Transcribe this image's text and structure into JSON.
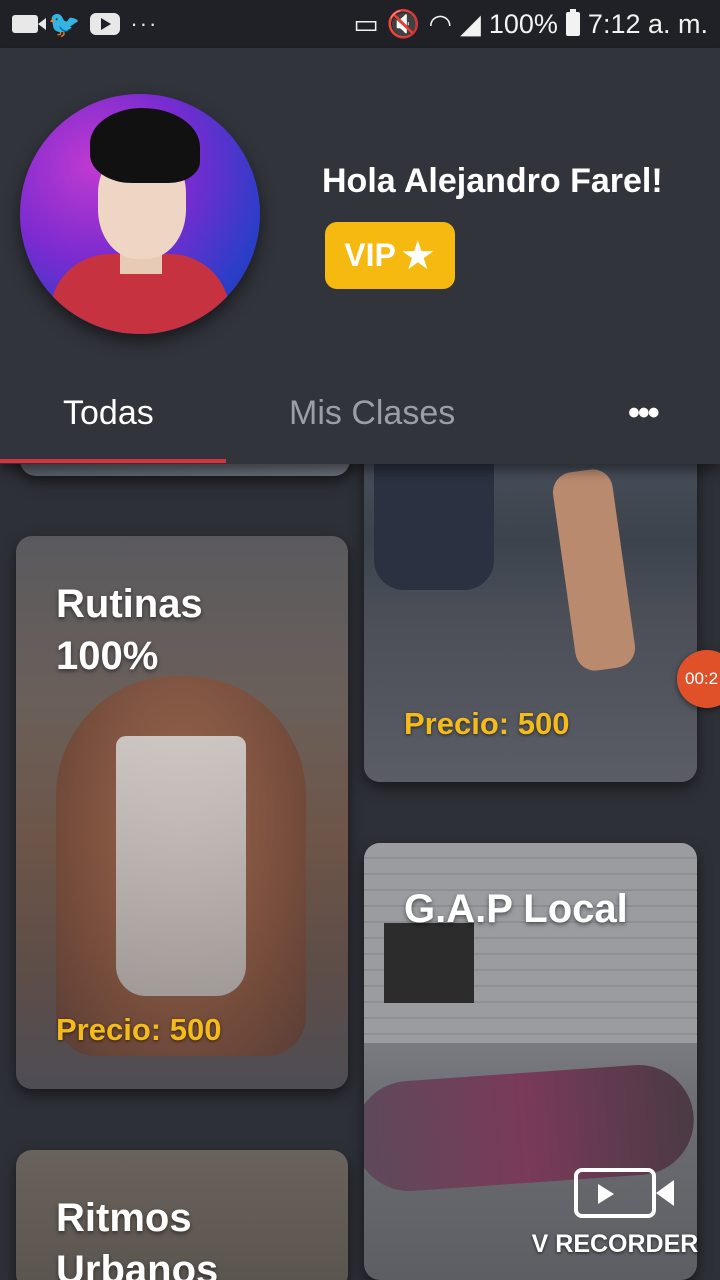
{
  "status_bar": {
    "battery": "100%",
    "time": "7:12 a. m.",
    "left_icons": [
      "video-camera-icon",
      "twitter-icon",
      "youtube-icon",
      "more-notifications-icon"
    ],
    "right_icons": [
      "cast-icon",
      "mute-icon",
      "wifi-icon",
      "signal-icon",
      "battery-icon"
    ]
  },
  "profile": {
    "greeting": "Hola Alejandro Farel!",
    "badge": "VIP",
    "badge_icon": "star-icon"
  },
  "tabs": [
    {
      "label": "Todas",
      "selected": true
    },
    {
      "label": "Mis Clases",
      "selected": false
    }
  ],
  "tab_more_label": "•••",
  "cards": [
    {
      "title": "",
      "price": "Precio: 500"
    },
    {
      "title": "Rutinas 100%",
      "price": "Precio: 500"
    },
    {
      "title": "G.A.P Local",
      "price": ""
    },
    {
      "title": "Ritmos Urbanos",
      "price": ""
    }
  ],
  "overlay": {
    "recorder_timer": "00:2",
    "recorder_label": "V RECORDER"
  },
  "colors": {
    "accent_tab": "#d8313d",
    "vip": "#f6b90f",
    "price": "#f4bb1a",
    "background": "#2d3037"
  }
}
